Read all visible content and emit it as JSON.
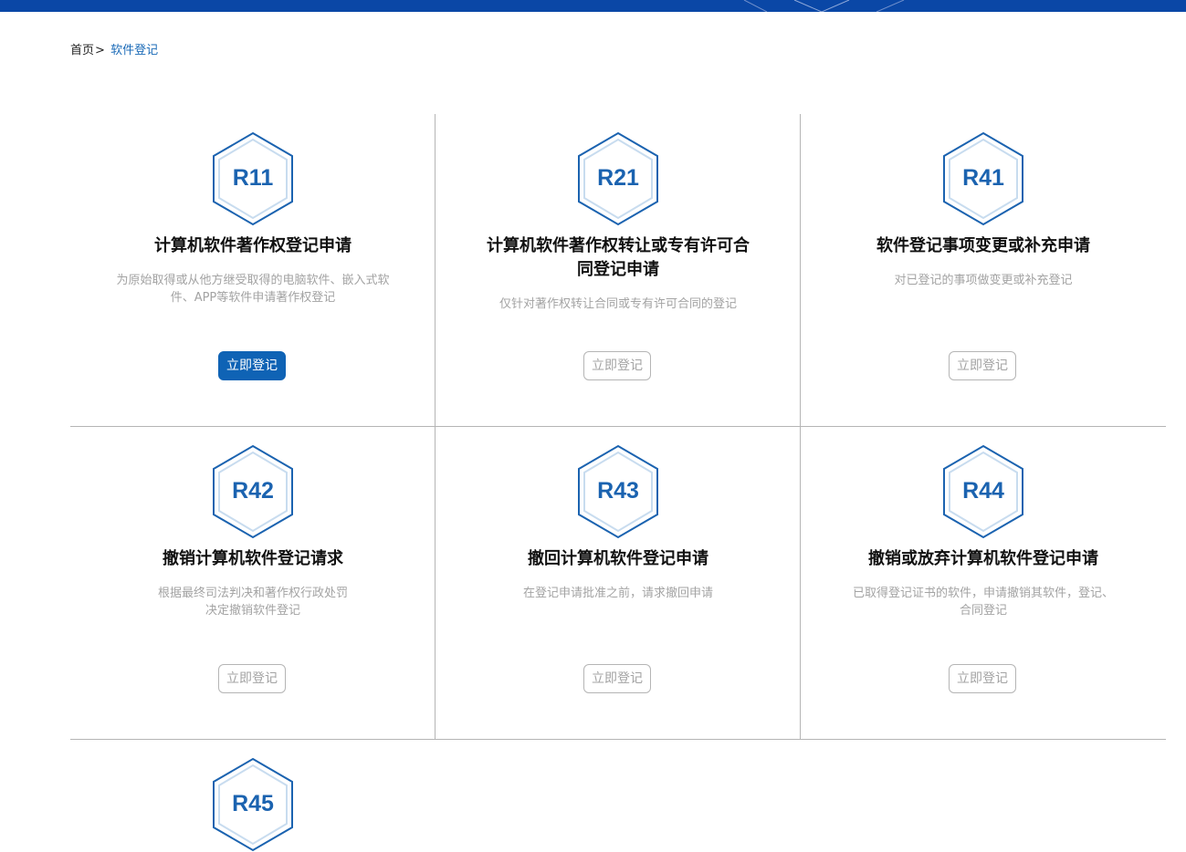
{
  "breadcrumb": {
    "home": "首页",
    "separator": ">",
    "current": "软件登记"
  },
  "colors": {
    "accent": "#0f63b5",
    "top_bar": "#0a47a6",
    "hex_stroke": "#1b63b0",
    "hex_inner": "#c8dcef",
    "muted_text": "#a3a3a3",
    "divider": "#b5b5b5"
  },
  "icons": {
    "hexagon": "hexagon-badge-icon"
  },
  "cards": [
    {
      "code": "R11",
      "title": "计算机软件著作权登记申请",
      "desc": "为原始取得或从他方继受取得的电脑软件、嵌入式软件、APP等软件申请著作权登记",
      "button": "立即登记",
      "active": true
    },
    {
      "code": "R21",
      "title": "计算机软件著作权转让或专有许可合同登记申请",
      "desc": "仅针对著作权转让合同或专有许可合同的登记",
      "button": "立即登记",
      "active": false
    },
    {
      "code": "R41",
      "title": "软件登记事项变更或补充申请",
      "desc": "对已登记的事项做变更或补充登记",
      "button": "立即登记",
      "active": false
    },
    {
      "code": "R42",
      "title": "撤销计算机软件登记请求",
      "desc": "根据最终司法判决和著作权行政处罚决定撤销软件登记",
      "button": "立即登记",
      "active": false
    },
    {
      "code": "R43",
      "title": "撤回计算机软件登记申请",
      "desc": "在登记申请批准之前，请求撤回申请",
      "button": "立即登记",
      "active": false
    },
    {
      "code": "R44",
      "title": "撤销或放弃计算机软件登记申请",
      "desc": "已取得登记证书的软件，申请撤销其软件，登记、合同登记",
      "button": "立即登记",
      "active": false
    },
    {
      "code": "R45"
    }
  ]
}
